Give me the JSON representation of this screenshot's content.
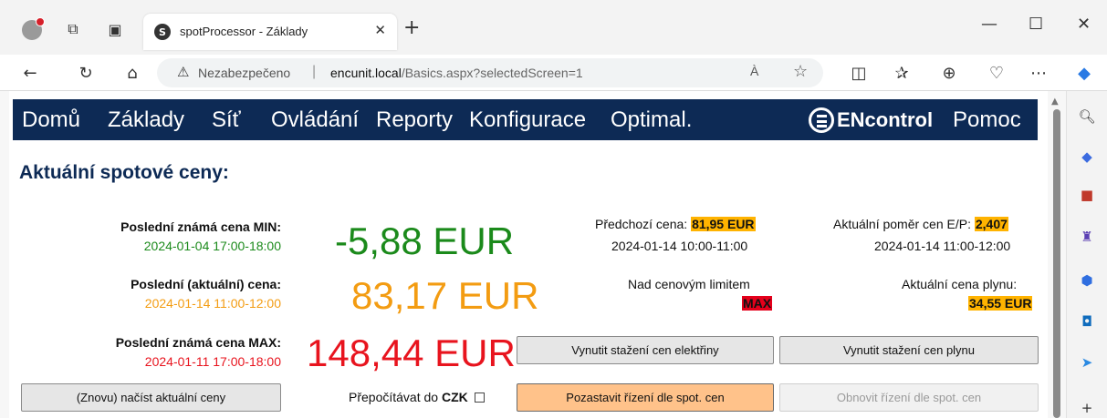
{
  "browser": {
    "tab_title": "spotProcessor - Základy",
    "tab_favicon_letter": "S",
    "insecure_label": "Nezabezpečeno",
    "url_separator": "|",
    "url_host": "encunit.local",
    "url_path": "/Basics.aspx?selectedScreen=1",
    "read_aloud_glyph": "À",
    "minimize_glyph": "—",
    "maximize_glyph": "☐",
    "close_glyph": "✕"
  },
  "menu": {
    "items": [
      "Domů",
      "Základy",
      "Síť",
      "Ovládání",
      "Reporty",
      "Konfigurace",
      "Optimal."
    ],
    "logo_text": "ENcontrol",
    "help": "Pomoc"
  },
  "page": {
    "title": "Aktuální spotové ceny:",
    "min": {
      "label": "Poslední známá cena MIN:",
      "time": "2024-01-04 17:00-18:00",
      "value": "-5,88 EUR",
      "color": "#1b8a1b"
    },
    "current": {
      "label": "Poslední (aktuální) cena:",
      "time": "2024-01-14 11:00-12:00",
      "value": "83,17 EUR",
      "color": "#f39c12"
    },
    "max": {
      "label": "Poslední známá cena MAX:",
      "time": "2024-01-11 17:00-18:00",
      "value": "148,44 EUR",
      "color": "#e8141e"
    },
    "previous": {
      "label": "Předchozí cena:",
      "value": "81,95 EUR",
      "time": "2024-01-14 10:00-11:00"
    },
    "limit": {
      "label": "Nad cenovým limitem",
      "value": "MAX"
    },
    "ratio": {
      "label": "Aktuální poměr cen E/P:",
      "value": "2,407",
      "time": "2024-01-14 11:00-12:00"
    },
    "gas": {
      "label": "Aktuální cena plynu:",
      "value": "34,55 EUR"
    },
    "buttons": {
      "reload": "(Znovu) načíst aktuální ceny",
      "force_electricity": "Vynutit stažení cen elektřiny",
      "force_gas": "Vynutit stažení cen plynu",
      "pause": "Pozastavit řízení dle spot. cen",
      "resume": "Obnovit řízení dle spot. cen"
    },
    "recalc": {
      "label": "Přepočítávat do",
      "currency": "CZK",
      "checked": false
    }
  }
}
